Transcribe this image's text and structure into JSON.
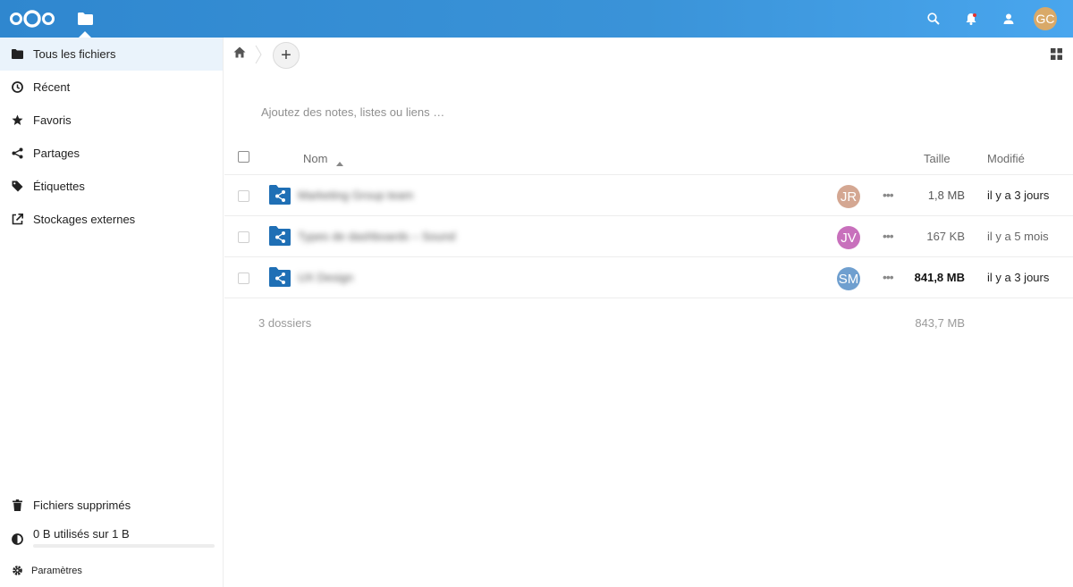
{
  "header": {
    "user_initials": "GC",
    "accent_color": "#3a93d8",
    "icons": [
      "logo-icon",
      "files-app-icon",
      "search-icon",
      "notifications-icon",
      "contacts-icon"
    ]
  },
  "sidebar": {
    "items": [
      {
        "label": "Tous les fichiers",
        "icon": "folder-icon",
        "active": true
      },
      {
        "label": "Récent",
        "icon": "clock-icon"
      },
      {
        "label": "Favoris",
        "icon": "star-icon"
      },
      {
        "label": "Partages",
        "icon": "share-icon"
      },
      {
        "label": "Étiquettes",
        "icon": "tag-icon"
      },
      {
        "label": "Stockages externes",
        "icon": "external-link-icon"
      }
    ],
    "trash_label": "Fichiers supprimés",
    "quota_label": "0 B utilisés sur 1 B",
    "settings_label": "Paramètres"
  },
  "main": {
    "notes_placeholder": "Ajoutez des notes, listes ou liens …",
    "add_label": "+",
    "columns": {
      "name": "Nom",
      "size": "Taille",
      "modified": "Modifié"
    },
    "rows": [
      {
        "name": "Marketing Group team",
        "initials": "JR",
        "avatar_color": "#d4a792",
        "size": "1,8 MB",
        "modified": "il y a 3 jours"
      },
      {
        "name": "Types de dashboards – Sound",
        "initials": "JV",
        "avatar_color": "#c870bc",
        "size": "167 KB",
        "modified": "il y a 5 mois"
      },
      {
        "name": "UX Design",
        "initials": "SM",
        "avatar_color": "#6f9fcf",
        "size": "841,8 MB",
        "modified": "il y a 3 jours"
      }
    ],
    "summary_count": "3 dossiers",
    "summary_size": "843,7 MB"
  }
}
